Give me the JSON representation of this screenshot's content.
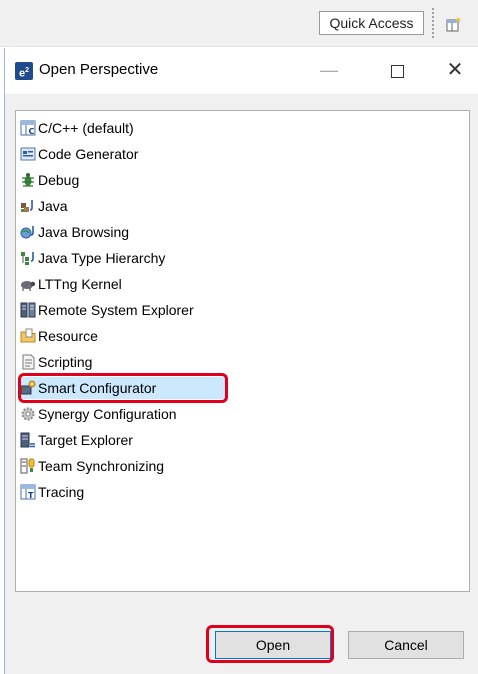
{
  "toolbar": {
    "quick_access_label": "Quick Access",
    "perspective_icon": "open-perspective-icon"
  },
  "dialog": {
    "title": "Open Perspective",
    "app_icon_label": "e",
    "app_icon_sup": "2",
    "controls": {
      "minimize": "—",
      "close": "✕"
    }
  },
  "perspectives": [
    {
      "label": "C/C++ (default)",
      "icon": "cpp-perspective-icon"
    },
    {
      "label": "Code Generator",
      "icon": "code-generator-icon"
    },
    {
      "label": "Debug",
      "icon": "debug-bug-icon"
    },
    {
      "label": "Java",
      "icon": "java-icon"
    },
    {
      "label": "Java Browsing",
      "icon": "java-browsing-icon"
    },
    {
      "label": "Java Type Hierarchy",
      "icon": "java-type-hierarchy-icon"
    },
    {
      "label": "LTTng Kernel",
      "icon": "lttng-kernel-icon"
    },
    {
      "label": "Remote System Explorer",
      "icon": "remote-system-explorer-icon"
    },
    {
      "label": "Resource",
      "icon": "resource-folder-icon"
    },
    {
      "label": "Scripting",
      "icon": "scripting-icon"
    },
    {
      "label": "Smart Configurator",
      "icon": "smart-configurator-icon",
      "selected": true
    },
    {
      "label": "Synergy Configuration",
      "icon": "synergy-configuration-icon"
    },
    {
      "label": "Target Explorer",
      "icon": "target-explorer-icon"
    },
    {
      "label": "Team Synchronizing",
      "icon": "team-synchronizing-icon"
    },
    {
      "label": "Tracing",
      "icon": "tracing-icon"
    }
  ],
  "buttons": {
    "open": "Open",
    "cancel": "Cancel"
  },
  "colors": {
    "selection": "#cce8ff",
    "highlight": "#e0001b",
    "default_button_border": "#0078d7"
  }
}
